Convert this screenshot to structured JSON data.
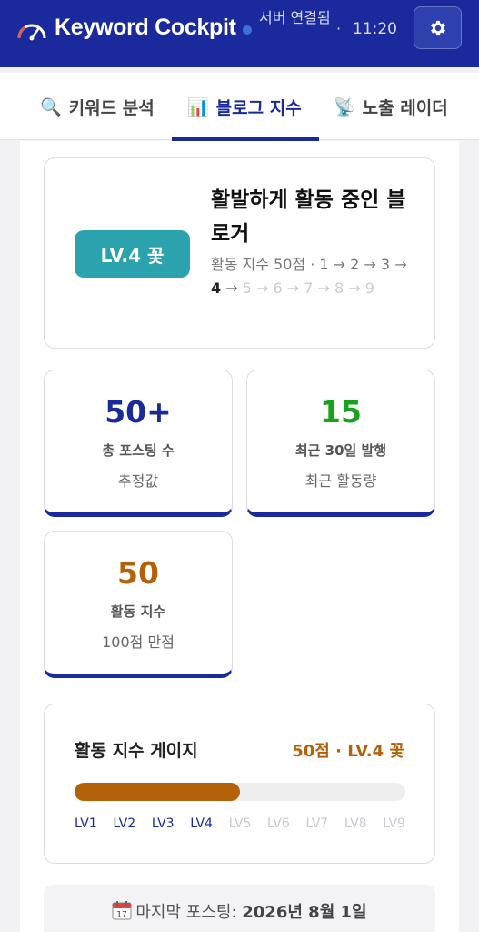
{
  "header": {
    "app_title": "Keyword Cockpit",
    "connection_status": "서버 연결됨",
    "separator": "·",
    "time": "11:20",
    "icons": {
      "logo": "speedometer-icon",
      "settings": "gear-icon"
    }
  },
  "tabs": [
    {
      "icon": "🔍",
      "label": "키워드 분석",
      "active": false
    },
    {
      "icon": "📊",
      "label": "블로그 지수",
      "active": true
    },
    {
      "icon": "📡",
      "label": "노출 레이더",
      "active": false
    }
  ],
  "level_card": {
    "badge": "LV.4 꽃",
    "title": "활발하게 활동 중인 블로거",
    "score_text": "활동 지수 50점 · ",
    "levels": [
      "1",
      "2",
      "3",
      "4",
      "5",
      "6",
      "7",
      "8",
      "9"
    ],
    "current_level": 4,
    "arrow": "→"
  },
  "stats": [
    {
      "value": "50+",
      "label": "총 포스팅 수",
      "sub": "추정값",
      "color": "#1a2a9c"
    },
    {
      "value": "15",
      "label": "최근 30일 발행",
      "sub": "최근 활동량",
      "color": "#18a21e"
    },
    {
      "value": "50",
      "label": "활동 지수",
      "sub": "100점 만점",
      "color": "#b3620a"
    }
  ],
  "gauge": {
    "title": "활동 지수 게이지",
    "score_label": "50점 · LV.4 꽃",
    "progress_percent": 50,
    "level_labels": [
      "LV1",
      "LV2",
      "LV3",
      "LV4",
      "LV5",
      "LV6",
      "LV7",
      "LV8",
      "LV9"
    ],
    "reached_up_to": 4
  },
  "last_post": {
    "icon": "calendar-icon",
    "label": "마지막 포스팅: ",
    "date": "2026년 8월 1일"
  },
  "colors": {
    "header_bg": "#1a2a9c",
    "badge_bg": "#2ba3ae",
    "accent_orange": "#b3620a",
    "accent_green": "#18a21e"
  }
}
